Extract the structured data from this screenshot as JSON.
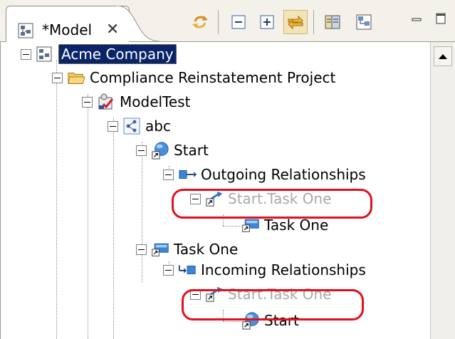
{
  "view": {
    "tab_title": "*Model",
    "tab_close": "✕",
    "tab_icon": "model-icon",
    "accent_color": "#0a246a",
    "highlight_color": "#e3101a"
  },
  "toolbar": {
    "buttons": [
      {
        "icon": "sync-icon"
      },
      {
        "icon": "collapse-all-icon"
      },
      {
        "icon": "expand-all-icon"
      },
      {
        "icon": "link-with-editor-icon",
        "pressed": true
      },
      {
        "icon": "filter-icon"
      },
      {
        "icon": "layout-icon"
      }
    ],
    "window_controls": [
      "minimize-icon",
      "maximize-icon"
    ]
  },
  "tree": {
    "root": "Acme Company",
    "project": "Compliance Reinstatement Project",
    "model": "ModelTest",
    "diagram": "abc",
    "start_node": "Start",
    "outgoing_group": "Outgoing Relationships",
    "outgoing_relation": "Start.Task One",
    "outgoing_target": "Task One",
    "task_node": "Task One",
    "incoming_group": "Incoming Relationships",
    "incoming_relation": "Start.Task One",
    "incoming_source": "Start"
  }
}
